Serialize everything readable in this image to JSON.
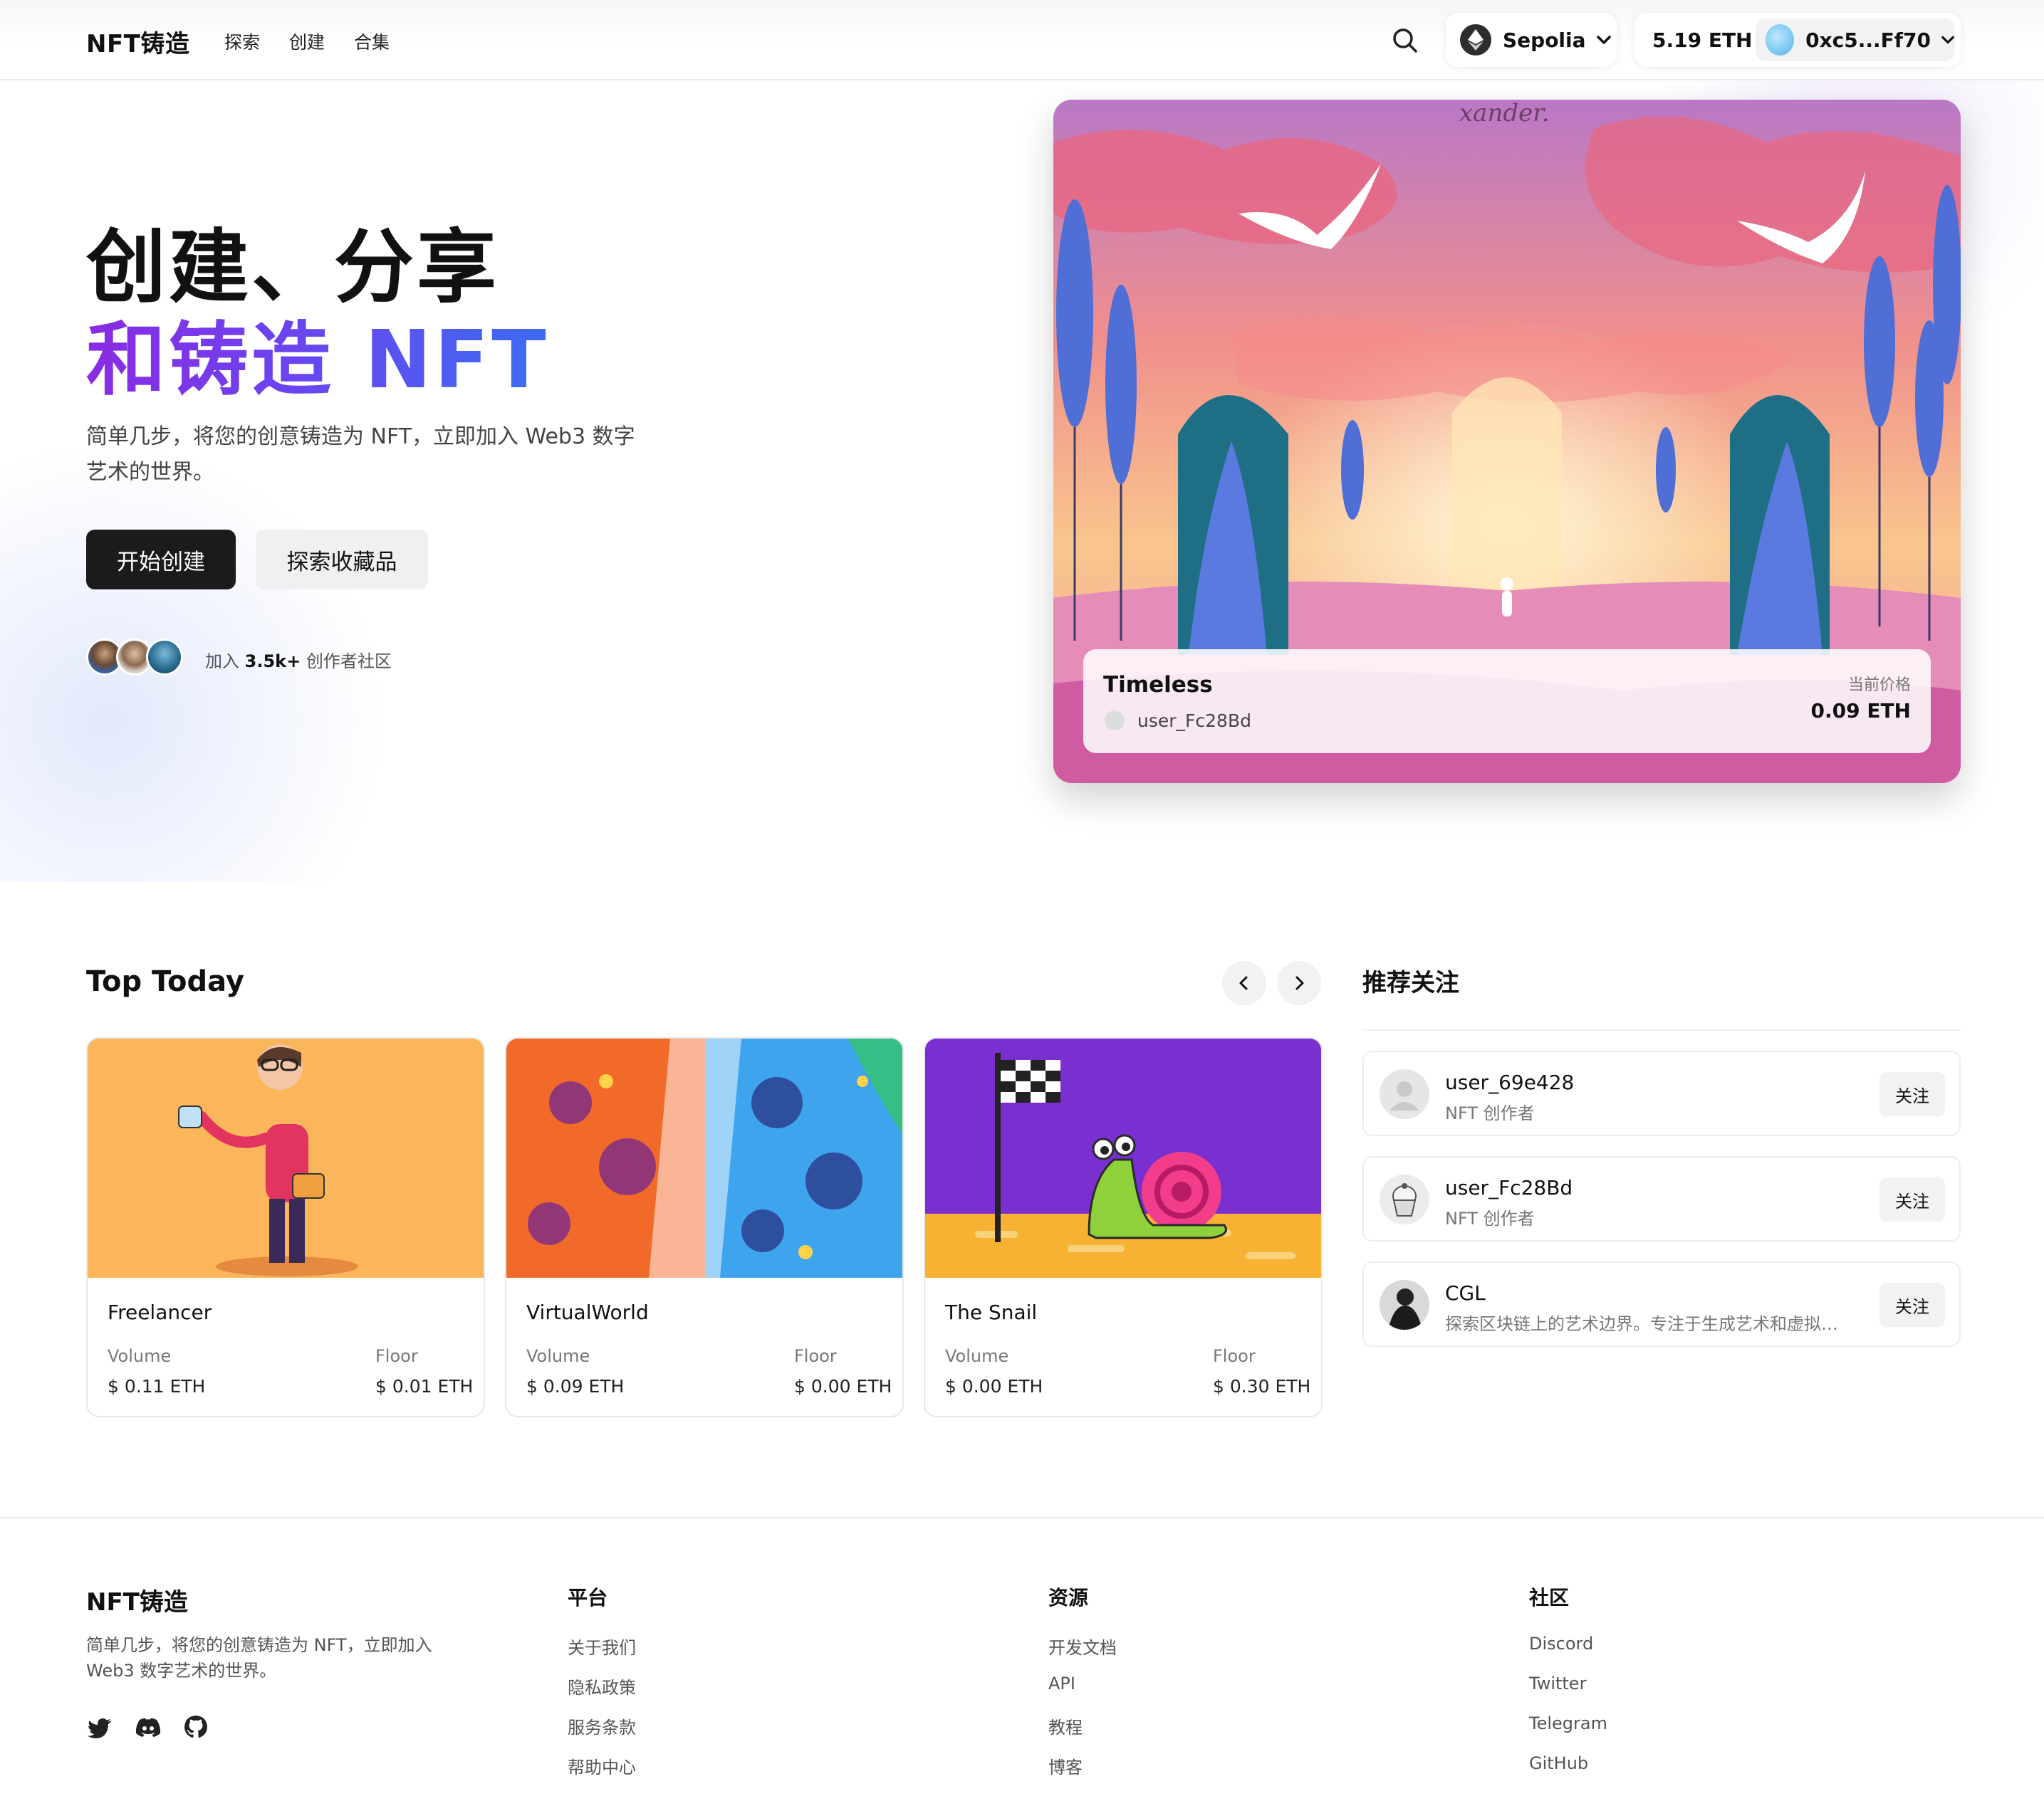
{
  "nav": {
    "logo": "NFT铸造",
    "links": [
      "探索",
      "创建",
      "合集"
    ],
    "network": "Sepolia",
    "balance": "5.19 ETH",
    "address": "0xc5...Ff70"
  },
  "hero": {
    "title_line1": "创建、分享",
    "title_line2": "和铸造 NFT",
    "subtitle": "简单几步，将您的创意铸造为 NFT，立即加入 Web3 数字艺术的世界。",
    "primary_button": "开始创建",
    "secondary_button": "探索收藏品",
    "community_prefix": "加入 ",
    "community_count": "3.5k+",
    "community_suffix": " 创作者社区",
    "featured": {
      "title": "Timeless",
      "owner": "user_Fc28Bd",
      "price_label": "当前价格",
      "price": "0.09 ETH",
      "art_text": "xander."
    }
  },
  "top_today": {
    "title": "Top Today",
    "volume_label": "Volume",
    "floor_label": "Floor",
    "items": [
      {
        "name": "Freelancer",
        "volume": "$ 0.11 ETH",
        "floor": "$ 0.01 ETH"
      },
      {
        "name": "VirtualWorld",
        "volume": "$ 0.09 ETH",
        "floor": "$ 0.00 ETH"
      },
      {
        "name": "The Snail",
        "volume": "$ 0.00 ETH",
        "floor": "$ 0.30 ETH"
      }
    ]
  },
  "recommend": {
    "title": "推荐关注",
    "follow_label": "关注",
    "users": [
      {
        "name": "user_69e428",
        "desc": "NFT 创作者"
      },
      {
        "name": "user_Fc28Bd",
        "desc": "NFT 创作者"
      },
      {
        "name": "CGL",
        "desc": "探索区块链上的艺术边界。专注于生成艺术和虚拟现实艺术的创作"
      }
    ]
  },
  "footer": {
    "logo": "NFT铸造",
    "description": "简单几步，将您的创意铸造为 NFT，立即加入 Web3 数字艺术的世界。",
    "columns": [
      {
        "title": "平台",
        "links": [
          "关于我们",
          "隐私政策",
          "服务条款",
          "帮助中心"
        ]
      },
      {
        "title": "资源",
        "links": [
          "开发文档",
          "API",
          "教程",
          "博客"
        ]
      },
      {
        "title": "社区",
        "links": [
          "Discord",
          "Twitter",
          "Telegram",
          "GitHub"
        ]
      }
    ]
  }
}
